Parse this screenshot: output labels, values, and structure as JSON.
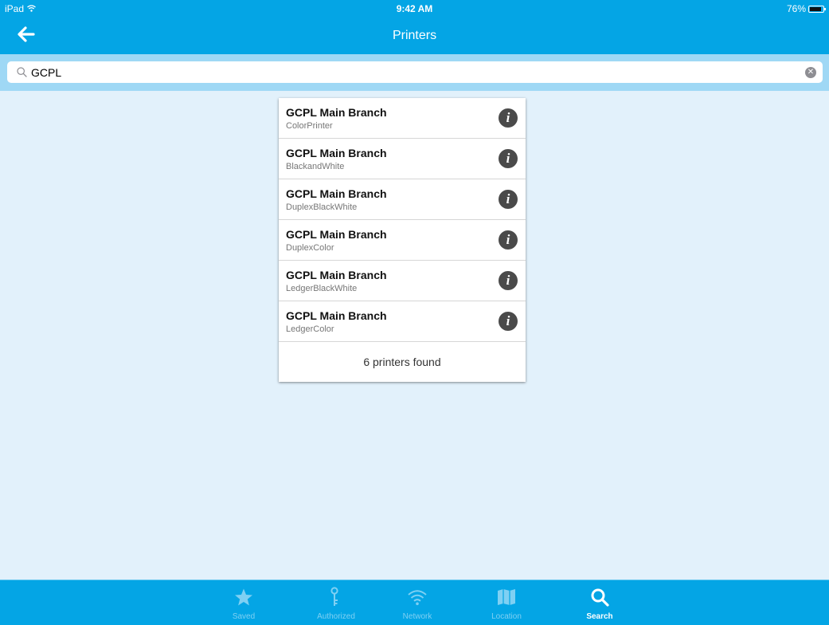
{
  "status_bar": {
    "device": "iPad",
    "time": "9:42 AM",
    "battery": "76%",
    "battery_level": 0.76
  },
  "nav": {
    "title": "Printers",
    "back_icon": "arrow-left-icon"
  },
  "search": {
    "value": "GCPL",
    "icon": "search-icon",
    "clear_icon": "clear-icon"
  },
  "results": {
    "items": [
      {
        "name": "GCPL Main Branch",
        "sub": "ColorPrinter"
      },
      {
        "name": "GCPL Main Branch",
        "sub": "BlackandWhite"
      },
      {
        "name": "GCPL Main Branch",
        "sub": "DuplexBlackWhite"
      },
      {
        "name": "GCPL Main Branch",
        "sub": "DuplexColor"
      },
      {
        "name": "GCPL Main Branch",
        "sub": "LedgerBlackWhite"
      },
      {
        "name": "GCPL Main Branch",
        "sub": "LedgerColor"
      }
    ],
    "info_glyph": "i",
    "footer": "6 printers found"
  },
  "tabs": [
    {
      "label": "Saved",
      "icon": "star-icon",
      "active": false
    },
    {
      "label": "Authorized",
      "icon": "key-icon",
      "active": false
    },
    {
      "label": "Network",
      "icon": "wifi-icon",
      "active": false
    },
    {
      "label": "Location",
      "icon": "map-icon",
      "active": false
    },
    {
      "label": "Search",
      "icon": "search-icon",
      "active": true
    }
  ],
  "colors": {
    "bar": "#04a5e5",
    "background": "#e2f1fb",
    "search_strip": "#9fd8f5",
    "tab_inactive": "#7fd0f3",
    "tab_active": "#ffffff"
  }
}
